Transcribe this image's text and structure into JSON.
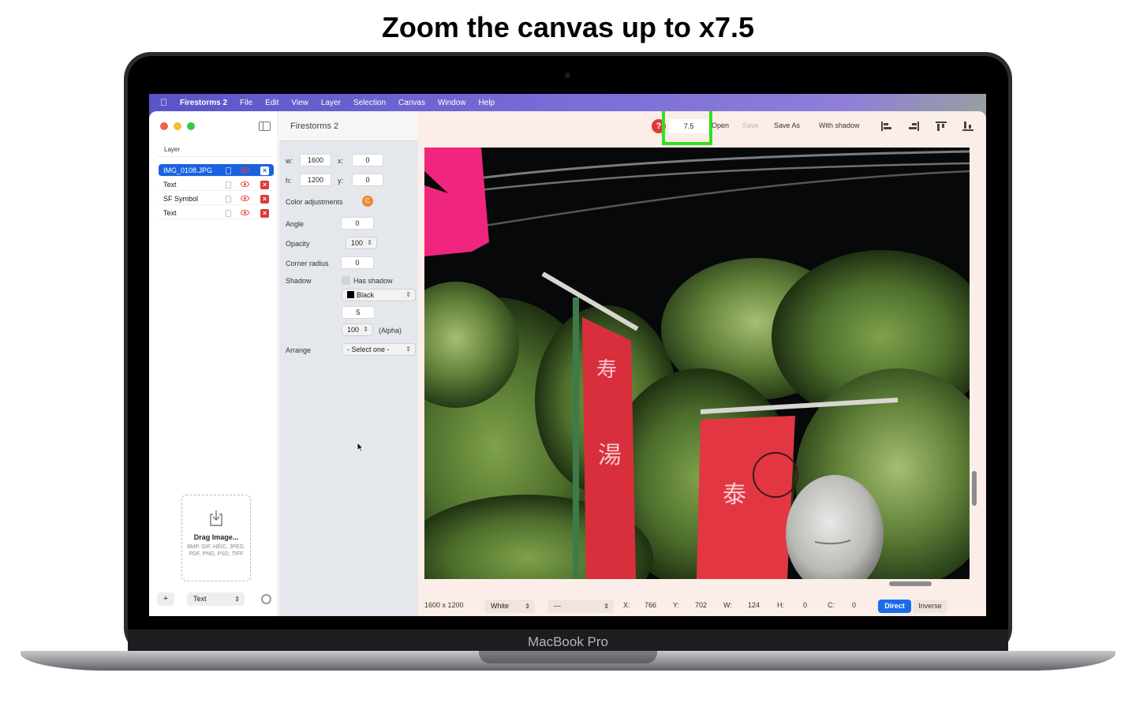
{
  "headline": "Zoom the canvas up to x7.5",
  "device_label": "MacBook Pro",
  "menubar": {
    "app_name": "Firestorms 2",
    "items": [
      "File",
      "Edit",
      "View",
      "Layer",
      "Selection",
      "Canvas",
      "Window",
      "Help"
    ]
  },
  "window": {
    "title": "Firestorms 2",
    "traffic_colors": [
      "#ee5f56",
      "#f5bd2f",
      "#37c84a"
    ]
  },
  "layers": {
    "header": "Layer",
    "items": [
      {
        "name": "IMG_0108.JPG",
        "selected": true
      },
      {
        "name": "Text",
        "selected": false
      },
      {
        "name": "SF Symbol",
        "selected": false
      },
      {
        "name": "Text",
        "selected": false
      }
    ]
  },
  "dropzone": {
    "title": "Drag Image...",
    "formats": "BMP, GIF, HEIC, JPEG, PDF, PNG, PSD, TIFF"
  },
  "sidebar_footer": {
    "add_label": "+",
    "type_value": "Text"
  },
  "inspector": {
    "w_label": "w:",
    "w_value": "1600",
    "x_label": "x:",
    "x_value": "0",
    "h_label": "h:",
    "h_value": "1200",
    "y_label": "y:",
    "y_value": "0",
    "color_adjustments_label": "Color adjustments",
    "color_adjustments_badge": "C",
    "angle_label": "Angle",
    "angle_value": "0",
    "opacity_label": "Opacity",
    "opacity_value": "100",
    "corner_radius_label": "Corner radius",
    "corner_radius_value": "0",
    "shadow_label": "Shadow",
    "has_shadow_label": "Has shadow",
    "shadow_color_value": "Black",
    "shadow_blur_value": "5",
    "shadow_alpha_value": "100",
    "shadow_alpha_suffix": "(Alpha)",
    "arrange_label": "Arrange",
    "arrange_value": "- Select one -"
  },
  "toolbar": {
    "help_label": "?",
    "zoom_value": "7.5",
    "open_label": "Open",
    "save_label": "Save",
    "save_as_label": "Save As",
    "with_shadow_label": "With shadow",
    "highlight_color": "#33e020"
  },
  "statusbar": {
    "dimensions": "1600 x 1200",
    "background_value": "White",
    "mode_value": "---",
    "x_label": "X:",
    "x_value": "766",
    "y_label": "Y:",
    "y_value": "702",
    "w_label": "W:",
    "w_value": "124",
    "h_label": "H:",
    "h_value": "0",
    "c_label": "C:",
    "c_value": "0",
    "direct_label": "Direct",
    "inverse_label": "Inverse"
  },
  "colors": {
    "accent": "#1a62e0",
    "close_red": "#e0393a",
    "canvas_bg": "#fbeee9",
    "inspector_bg": "#e4e7eb"
  }
}
